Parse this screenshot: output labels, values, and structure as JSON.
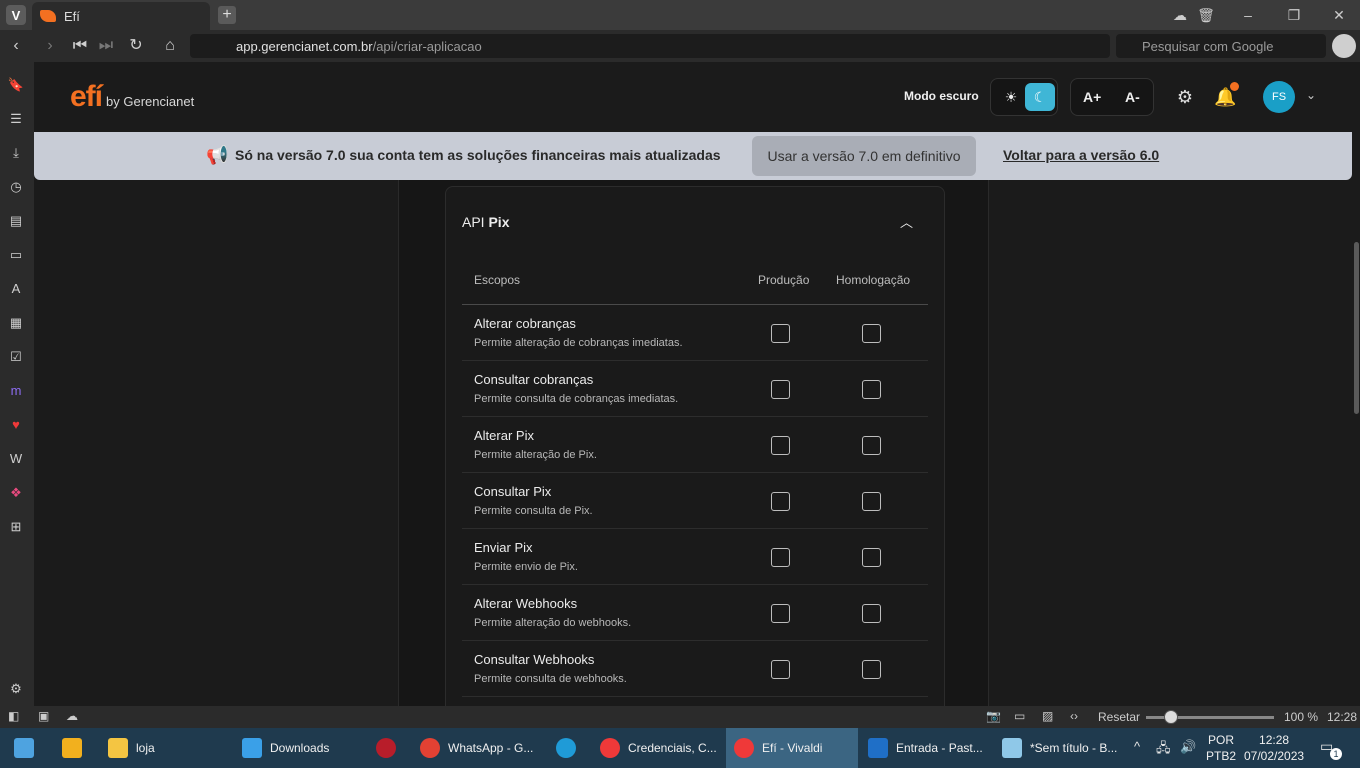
{
  "browser": {
    "tab_title": "Efí",
    "url_host": "app.gerencianet.com.br",
    "url_path": "/api/criar-aplicacao",
    "search_placeholder": "Pesquisar com Google"
  },
  "header": {
    "logo_text": "efí",
    "logo_by": "by Gerencianet",
    "dark_mode_label": "Modo escuro",
    "font_increase": "A+",
    "font_decrease": "A-",
    "avatar_initials": "FS",
    "accent_color": "#f37021",
    "toggle_color": "#3fb6d6"
  },
  "banner": {
    "text": "Só na versão 7.0 sua conta tem as soluções financeiras mais atualizadas",
    "primary_button": "Usar a versão 7.0 em definitivo",
    "link": "Voltar para a versão 6.0"
  },
  "card": {
    "title_prefix": "API",
    "title_bold": "Pix",
    "columns": {
      "scopes": "Escopos",
      "production": "Produção",
      "homologation": "Homologação"
    },
    "rows": [
      {
        "title": "Alterar cobranças",
        "desc": "Permite alteração de cobranças imediatas."
      },
      {
        "title": "Consultar cobranças",
        "desc": "Permite consulta de cobranças imediatas."
      },
      {
        "title": "Alterar Pix",
        "desc": "Permite alteração de Pix."
      },
      {
        "title": "Consultar Pix",
        "desc": "Permite consulta de Pix."
      },
      {
        "title": "Enviar Pix",
        "desc": "Permite envio de Pix."
      },
      {
        "title": "Alterar Webhooks",
        "desc": "Permite alteração do webhooks."
      },
      {
        "title": "Consultar Webhooks",
        "desc": "Permite consulta de webhooks."
      }
    ]
  },
  "statusbar": {
    "reset_label": "Resetar",
    "zoom": "100 %",
    "time": "12:28"
  },
  "taskbar": {
    "items": [
      {
        "label": "loja"
      },
      {
        "label": "Downloads"
      },
      {
        "label": "WhatsApp - G..."
      },
      {
        "label": "Credenciais, C..."
      },
      {
        "label": "Efí - Vivaldi"
      },
      {
        "label": "Entrada - Past..."
      },
      {
        "label": "*Sem título - B..."
      }
    ],
    "lang": "POR",
    "lang_sub": "PTB2",
    "clock_time": "12:28",
    "clock_date": "07/02/2023",
    "notif_count": "1"
  }
}
